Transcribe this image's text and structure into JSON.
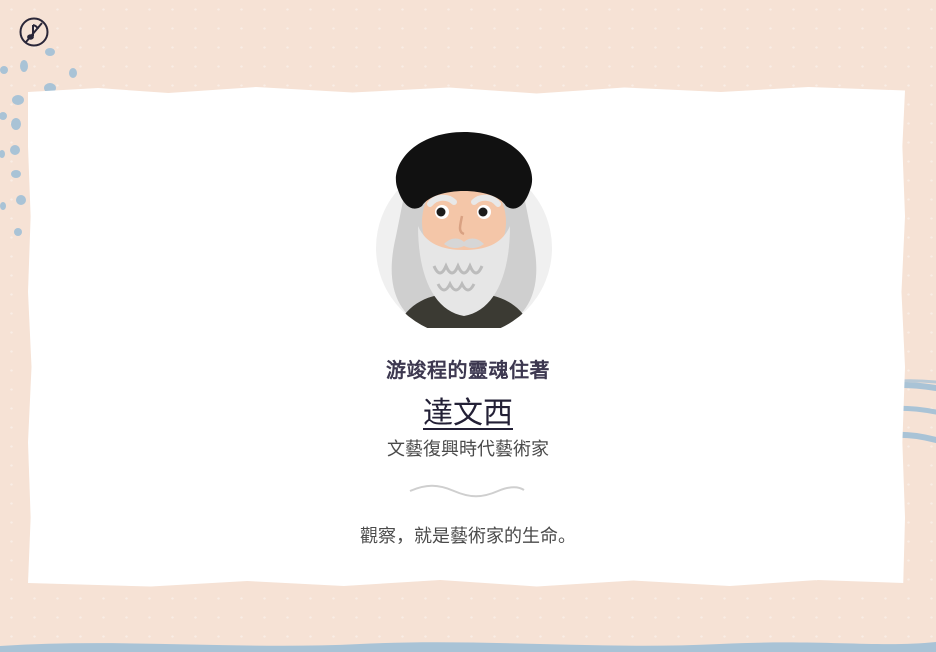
{
  "music_toggle": {
    "icon": "music-muted-icon"
  },
  "colors": {
    "background": "#f6e2d5",
    "card": "#ffffff",
    "accent_blue": "#a9c3d6",
    "title_text": "#3d3850"
  },
  "profile": {
    "subtitle": "游竣程的靈魂住著",
    "name": "達文西",
    "role": "文藝復興時代藝術家",
    "quote": "觀察，就是藝術家的生命。",
    "avatar_icon": "bearded-old-man-portrait"
  }
}
